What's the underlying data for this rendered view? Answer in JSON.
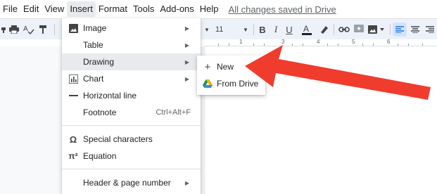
{
  "menubar": {
    "items": [
      "File",
      "Edit",
      "View",
      "Insert",
      "Format",
      "Tools",
      "Add-ons",
      "Help"
    ],
    "save_status": "All changes saved in Drive"
  },
  "toolbar": {
    "font_size": "11"
  },
  "ruler": {
    "numbers": [
      "1",
      "2",
      "3",
      "4",
      "5",
      "6"
    ]
  },
  "insert_menu": {
    "items": [
      {
        "label": "Image",
        "icon": "image-icon",
        "submenu": true
      },
      {
        "label": "Table",
        "icon": "",
        "submenu": true
      },
      {
        "label": "Drawing",
        "icon": "",
        "submenu": true
      },
      {
        "label": "Chart",
        "icon": "chart-icon",
        "submenu": true
      },
      {
        "label": "Horizontal line",
        "icon": "horizontal-line-icon",
        "submenu": false
      },
      {
        "label": "Footnote",
        "icon": "",
        "submenu": false,
        "shortcut": "Ctrl+Alt+F"
      },
      {
        "label": "Special characters",
        "icon": "omega-icon",
        "submenu": false
      },
      {
        "label": "Equation",
        "icon": "pi-icon",
        "submenu": false
      },
      {
        "label": "Header & page number",
        "icon": "",
        "submenu": true
      }
    ]
  },
  "drawing_submenu": {
    "items": [
      {
        "label": "New",
        "icon": "plus-icon"
      },
      {
        "label": "From Drive",
        "icon": "drive-icon"
      }
    ]
  },
  "colors": {
    "highlight_arrow": "#f03c2d",
    "drive_green": "#0f9d58",
    "drive_yellow": "#f4b400",
    "drive_blue": "#4285f4",
    "align_active": "#1a73e8"
  }
}
